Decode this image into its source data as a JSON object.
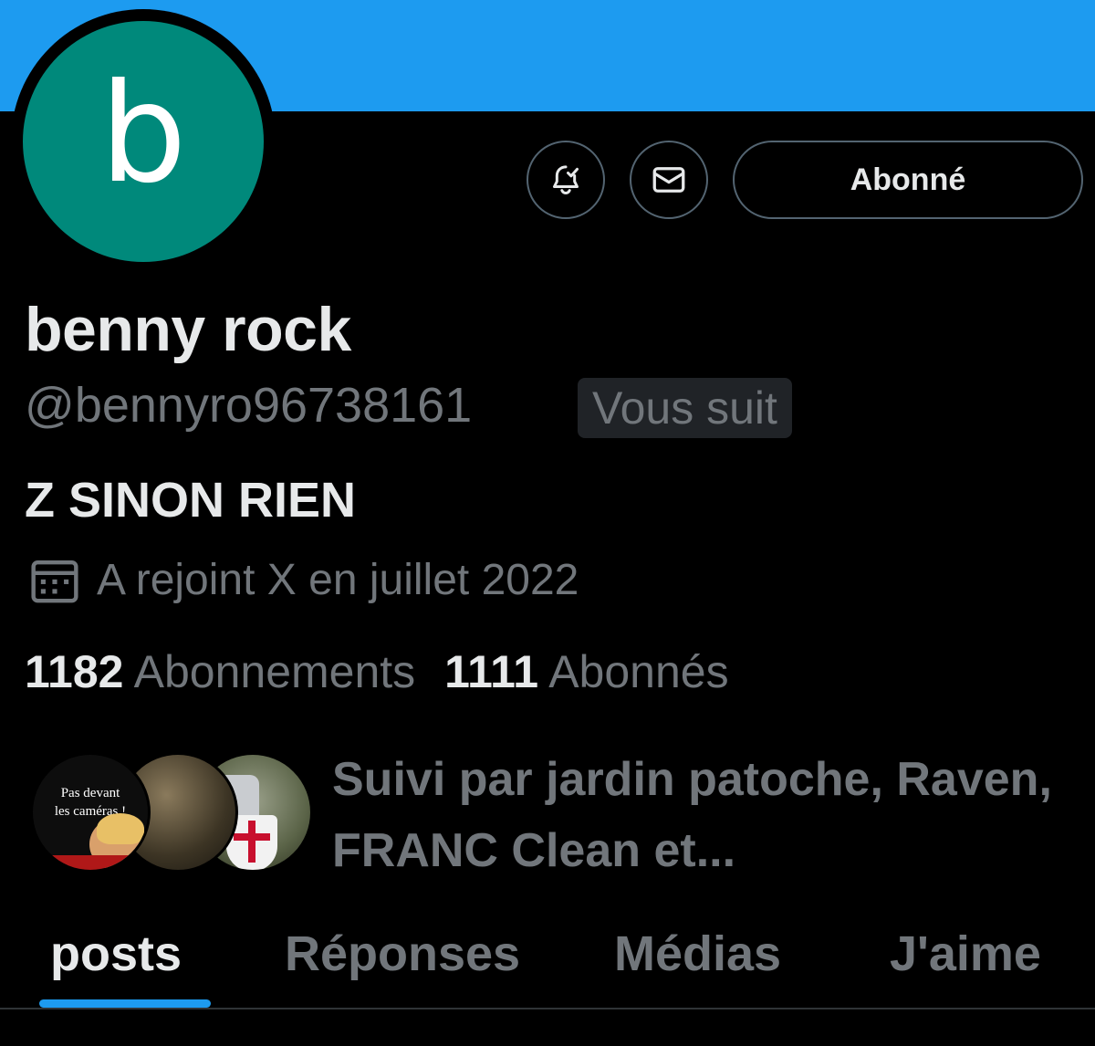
{
  "colors": {
    "banner": "#1d9bf0",
    "avatar_bg": "#00897b",
    "accent": "#1d9bf0",
    "secondary_text": "#71767b",
    "primary_text": "#e7e9ea"
  },
  "profile": {
    "avatar_letter": "b",
    "display_name": "benny rock",
    "handle": "@bennyro96738161",
    "follows_you_badge": "Vous suit",
    "bio": "Z SINON RIEN",
    "joined": "A rejoint X en juillet 2022",
    "following_count": "1182",
    "following_label": "Abonnements",
    "followers_count": "1111",
    "followers_label": "Abonnés"
  },
  "actions": {
    "notify_icon": "bell-check-icon",
    "message_icon": "envelope-icon",
    "follow_label": "Abonné"
  },
  "followed_by": {
    "avatar_1_line1": "Pas devant",
    "avatar_1_line2": "les caméras !",
    "text": "Suivi par jardin patoche, Raven, FRANC Clean et..."
  },
  "tabs": [
    {
      "label": "posts",
      "active": true
    },
    {
      "label": "Réponses",
      "active": false
    },
    {
      "label": "Médias",
      "active": false
    },
    {
      "label": "J'aime",
      "active": false
    }
  ]
}
